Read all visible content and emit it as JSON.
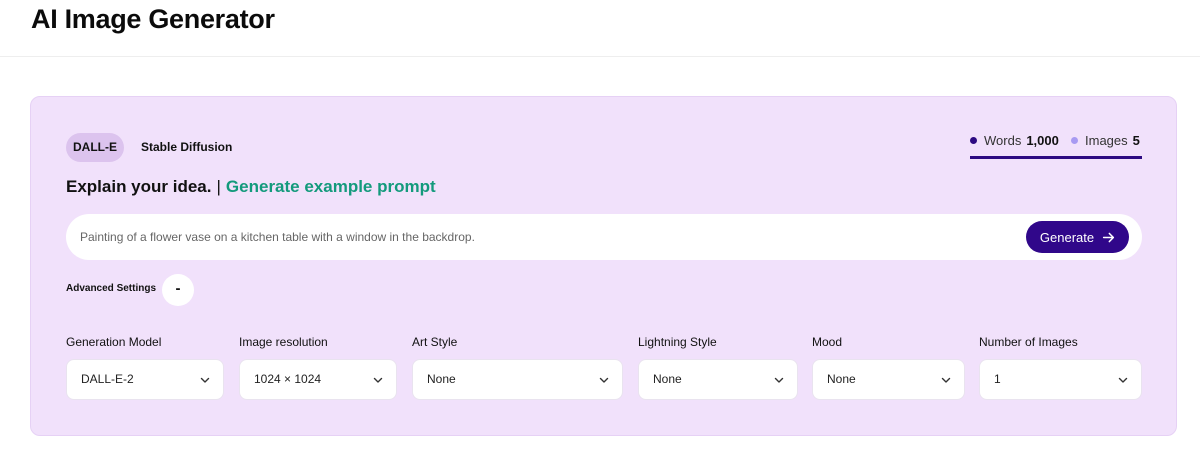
{
  "header": {
    "title": "AI Image Generator"
  },
  "tabs": [
    {
      "label": "DALL-E",
      "active": true
    },
    {
      "label": "Stable Diffusion",
      "active": false
    }
  ],
  "usage": {
    "words": {
      "label": "Words",
      "value": "1,000",
      "color": "#2d0a82"
    },
    "images": {
      "label": "Images",
      "value": "5",
      "color": "#a89af2"
    }
  },
  "headline": {
    "text": "Explain your idea.",
    "separator": "|",
    "link": "Generate example prompt"
  },
  "prompt": {
    "placeholder": "Painting of a flower vase on a kitchen table with a window in the backdrop."
  },
  "generate_button": {
    "label": "Generate",
    "icon": "arrow-right-icon"
  },
  "advanced": {
    "label": "Advanced Settings",
    "toggle": "-"
  },
  "settings": [
    {
      "label": "Generation Model",
      "value": "DALL-E-2"
    },
    {
      "label": "Image resolution",
      "value": "1024 × 1024"
    },
    {
      "label": "Art Style",
      "value": "None"
    },
    {
      "label": "Lightning Style",
      "value": "None"
    },
    {
      "label": "Mood",
      "value": "None"
    },
    {
      "label": "Number of Images",
      "value": "1"
    }
  ],
  "colors": {
    "card_bg": "#f1e1fb",
    "accent": "#30078a",
    "link": "#139a7c",
    "active_tab": "#dcc3ee"
  }
}
